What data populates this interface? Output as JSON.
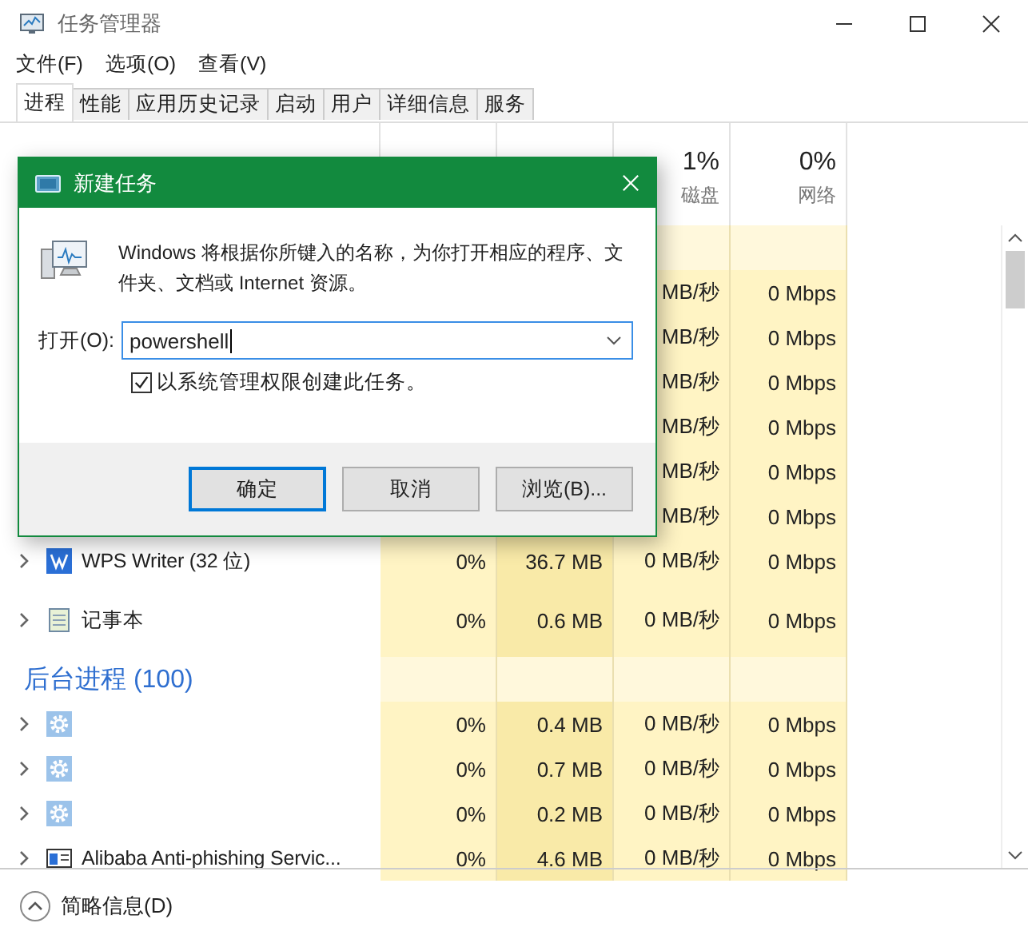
{
  "window": {
    "title": "任务管理器"
  },
  "menu": [
    "文件(F)",
    "选项(O)",
    "查看(V)"
  ],
  "tabs": [
    {
      "label": "进程",
      "selected": true
    },
    {
      "label": "性能",
      "selected": false
    },
    {
      "label": "应用历史记录",
      "selected": false
    },
    {
      "label": "启动",
      "selected": false
    },
    {
      "label": "用户",
      "selected": false
    },
    {
      "label": "详细信息",
      "selected": false
    },
    {
      "label": "服务",
      "selected": false
    }
  ],
  "header": {
    "disk": {
      "percent": "1%",
      "label": "磁盘"
    },
    "network": {
      "percent": "0%",
      "label": "网络"
    }
  },
  "rows": [
    {
      "kind": "group"
    },
    {
      "kind": "process",
      "disk": "MB/秒",
      "network": "0 Mbps"
    },
    {
      "kind": "process",
      "disk": "MB/秒",
      "network": "0 Mbps"
    },
    {
      "kind": "process",
      "disk": "MB/秒",
      "network": "0 Mbps"
    },
    {
      "kind": "process",
      "disk": "MB/秒",
      "network": "0 Mbps"
    },
    {
      "kind": "process",
      "disk": "MB/秒",
      "network": "0 Mbps"
    },
    {
      "kind": "process",
      "disk": "MB/秒",
      "network": "0 Mbps"
    },
    {
      "kind": "writer",
      "name": "WPS Writer (32 位)",
      "cpu": "0%",
      "memory": "36.7 MB",
      "disk": "0 MB/秒",
      "network": "0 Mbps"
    },
    {
      "kind": "notepad",
      "name": "记事本",
      "cpu": "0%",
      "memory": "0.6 MB",
      "disk": "0 MB/秒",
      "network": "0 Mbps"
    },
    {
      "kind": "group",
      "label": "后台进程 (100)"
    },
    {
      "kind": "service",
      "cpu": "0%",
      "memory": "0.4 MB",
      "disk": "0 MB/秒",
      "network": "0 Mbps"
    },
    {
      "kind": "service",
      "cpu": "0%",
      "memory": "0.7 MB",
      "disk": "0 MB/秒",
      "network": "0 Mbps"
    },
    {
      "kind": "service",
      "cpu": "0%",
      "memory": "0.2 MB",
      "disk": "0 MB/秒",
      "network": "0 Mbps"
    },
    {
      "kind": "program",
      "name": "Alibaba Anti-phishing Servic...",
      "cpu": "0%",
      "memory": "4.6 MB",
      "disk": "0 MB/秒",
      "network": "0 Mbps"
    }
  ],
  "footer": {
    "label": "简略信息(D)"
  },
  "dialog": {
    "title": "新建任务",
    "message": "Windows 将根据你所键入的名称，为你打开相应的程序、文件夹、文档或 Internet 资源。",
    "open_label": "打开(O):",
    "value": "powershell",
    "checkbox": {
      "label": "以系统管理权限创建此任务。",
      "checked": true
    },
    "buttons": [
      {
        "label": "确定",
        "focused": true
      },
      {
        "label": "取消",
        "focused": false
      },
      {
        "label": "浏览(B)...",
        "focused": false
      }
    ]
  }
}
